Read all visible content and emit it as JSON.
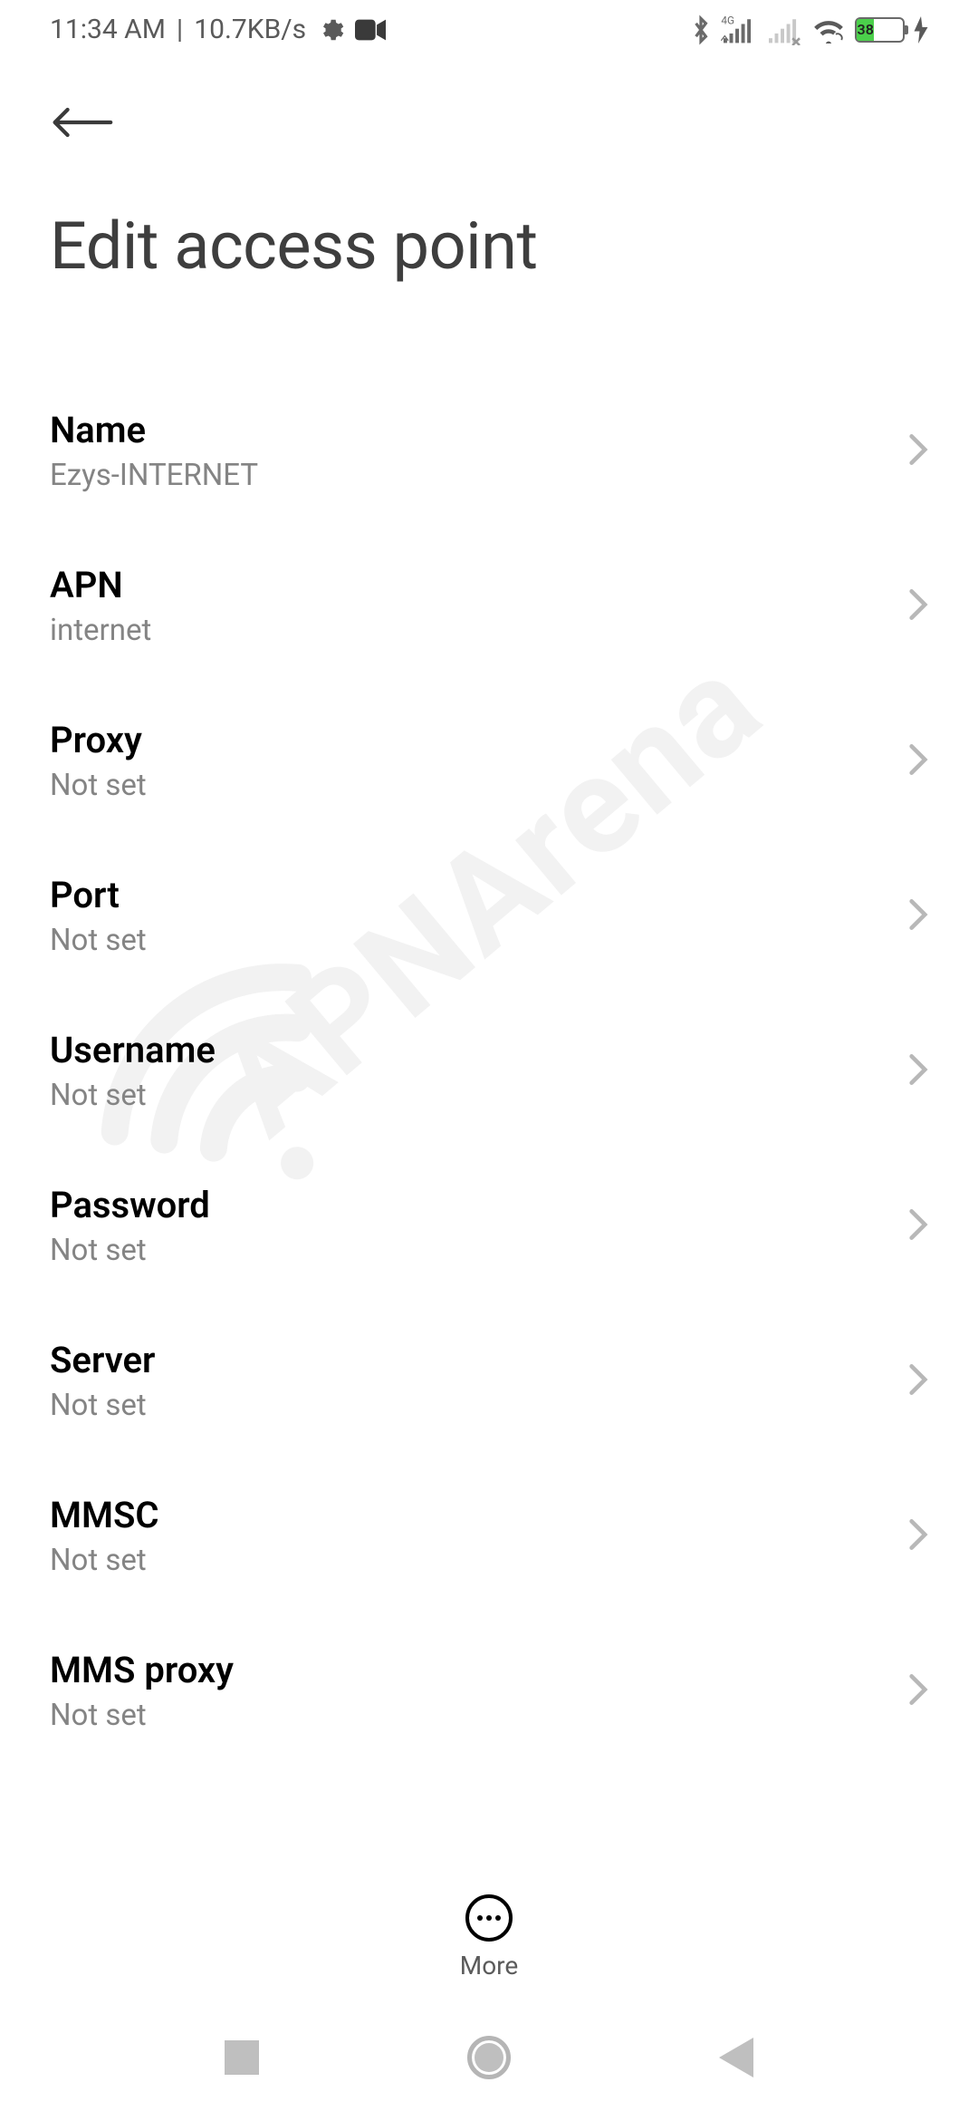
{
  "statusBar": {
    "time": "11:34 AM",
    "separator": "|",
    "speed": "10.7KB/s",
    "batteryPercent": "38"
  },
  "page": {
    "title": "Edit access point"
  },
  "settings": [
    {
      "label": "Name",
      "value": "Ezys-INTERNET"
    },
    {
      "label": "APN",
      "value": "internet"
    },
    {
      "label": "Proxy",
      "value": "Not set"
    },
    {
      "label": "Port",
      "value": "Not set"
    },
    {
      "label": "Username",
      "value": "Not set"
    },
    {
      "label": "Password",
      "value": "Not set"
    },
    {
      "label": "Server",
      "value": "Not set"
    },
    {
      "label": "MMSC",
      "value": "Not set"
    },
    {
      "label": "MMS proxy",
      "value": "Not set"
    }
  ],
  "toolbar": {
    "more": "More"
  },
  "watermark": "APNArena"
}
